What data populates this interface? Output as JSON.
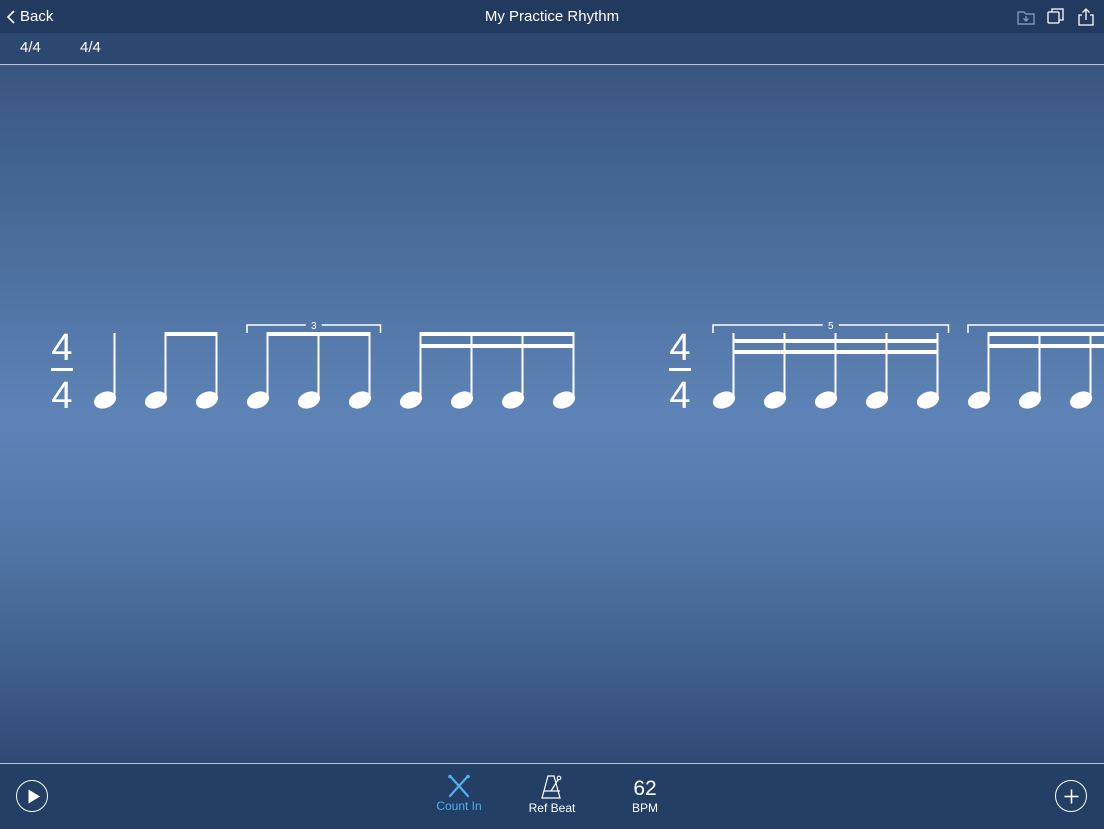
{
  "header": {
    "back_label": "Back",
    "title": "My Practice Rhythm",
    "icons": [
      "save-to-folder-icon",
      "duplicate-icon",
      "share-icon"
    ]
  },
  "meter_bar": {
    "meters": [
      "4/4",
      "4/4"
    ]
  },
  "score": {
    "measures": [
      {
        "time_signature": {
          "top": "4",
          "bottom": "4"
        },
        "groups": [
          {
            "type": "quarter",
            "notes": 1
          },
          {
            "type": "eighth-pair",
            "notes": 2
          },
          {
            "type": "eighth-triplet",
            "notes": 3,
            "tuplet_label": "3"
          },
          {
            "type": "sixteenth-group",
            "notes": 4
          }
        ]
      },
      {
        "time_signature": {
          "top": "4",
          "bottom": "4"
        },
        "groups": [
          {
            "type": "sixteenth-quintuplet",
            "notes": 5,
            "tuplet_label": "5"
          },
          {
            "type": "sixteenth-group",
            "notes": 3,
            "partially_visible": true
          }
        ]
      }
    ]
  },
  "toolbar": {
    "play_icon": "play-icon",
    "count_in_label": "Count In",
    "count_in_icon": "crossed-drumsticks-icon",
    "ref_beat_label": "Ref Beat",
    "ref_beat_icon": "metronome-icon",
    "bpm_value": "62",
    "bpm_label": "BPM",
    "add_icon": "plus-icon",
    "active_color": "#4fb0ea"
  }
}
